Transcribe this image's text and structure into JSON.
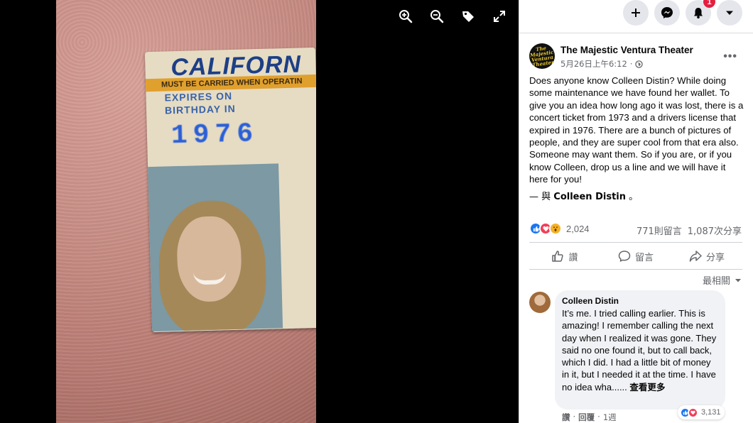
{
  "viewer": {
    "photo": {
      "license_title": "CALIFORN",
      "license_band": "MUST BE CARRIED WHEN OPERATIN",
      "license_expires": "EXPIRES ON\nBIRTHDAY IN",
      "license_year": "1976"
    },
    "tools": [
      "zoom-in-icon",
      "zoom-out-icon",
      "tag-icon",
      "fullscreen-icon"
    ]
  },
  "topbar": {
    "buttons": [
      "create-icon",
      "messenger-icon",
      "notifications-icon",
      "account-menu-icon"
    ],
    "notification_count": "1"
  },
  "post": {
    "page_name": "The Majestic Ventura Theater",
    "page_avatar_text": "The Majestic Ventura Theater",
    "timestamp": "5月26日上午6:12",
    "separator": "·",
    "text": "Does anyone know Colleen Distin? While doing some maintenance we have found her wallet. To give you an idea how long ago it was lost, there is a concert ticket from 1973 and a drivers license that expired in 1976. There are a bunch of pictures of people, and they are super cool from that era also. Someone may want them. So if you are, or if you know Colleen, drop us a line and we will have it here for you!",
    "tag_prefix": "— 與",
    "tag_name": "Colleen Distin",
    "tag_suffix": "。",
    "reaction_count": "2,024",
    "comments_count": "771則留言",
    "shares_count": "1,087次分享",
    "actions": {
      "like": "讚",
      "comment": "留言",
      "share": "分享"
    },
    "sort_label": "最相關"
  },
  "comment": {
    "author": "Colleen Distin",
    "text": "It’s me. I tried calling earlier. This is amazing! I remember calling the next day when I realized it was gone. They said no one found it, but to call back, which I did. I had a little bit of money in it, but I needed it at the time. I have no idea wha......",
    "see_more": "查看更多",
    "reaction_count": "3,131",
    "like": "讚",
    "dot": "·",
    "reply": "回覆",
    "age": "1週"
  },
  "colors": {
    "facebook_blue": "#1877f2",
    "love_red": "#f33e58",
    "wow_yellow": "#f7b125",
    "secondary_text": "#65676b"
  }
}
